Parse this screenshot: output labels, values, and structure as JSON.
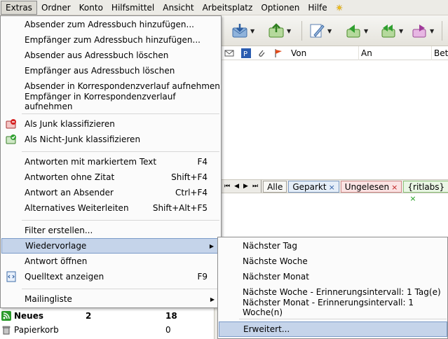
{
  "menubar": {
    "items": [
      "Extras",
      "Ordner",
      "Konto",
      "Hilfsmittel",
      "Ansicht",
      "Arbeitsplatz",
      "Optionen",
      "Hilfe"
    ],
    "extra_icon": "sun-icon"
  },
  "message_list": {
    "columns": {
      "from": "Von",
      "to": "An",
      "subject": "Betr"
    }
  },
  "tabs": {
    "all": "Alle",
    "parked": "Geparkt",
    "unread": "Ungelesen",
    "ritlabs": "{ritlabs}",
    "close": "×"
  },
  "extras_menu": {
    "group1": [
      "Absender zum Adressbuch hinzufügen...",
      "Empfänger zum Adressbuch hinzufügen...",
      "Absender aus Adressbuch löschen",
      "Empfänger aus Adressbuch löschen",
      "Absender in Korrespondenzverlauf aufnehmen",
      "Empfänger in Korrespondenzverlauf aufnehmen"
    ],
    "junk": "Als Junk klassifizieren",
    "not_junk": "Als Nicht-Junk klassifizieren",
    "reply_marked": {
      "label": "Antworten mit markiertem Text",
      "shortcut": "F4"
    },
    "reply_no_quote": {
      "label": "Antworten ohne Zitat",
      "shortcut": "Shift+F4"
    },
    "reply_sender": {
      "label": "Antwort an Absender",
      "shortcut": "Ctrl+F4"
    },
    "alt_forward": {
      "label": "Alternatives Weiterleiten",
      "shortcut": "Shift+Alt+F5"
    },
    "create_filter": "Filter erstellen...",
    "followup": "Wiedervorlage",
    "open_reply": "Antwort öffnen",
    "show_source": {
      "label": "Quelltext anzeigen",
      "shortcut": "F9"
    },
    "mailing_list": "Mailingliste"
  },
  "followup_submenu": {
    "items": [
      "Nächster Tag",
      "Nächste Woche",
      "Nächster Monat",
      "Nächste Woche - Erinnerungsintervall: 1 Tag(e)",
      "Nächster Monat - Erinnerungsintervall: 1 Woche(n)"
    ],
    "advanced": "Erweitert..."
  },
  "folders": [
    {
      "name": "Neues",
      "unread": "2",
      "total": "18",
      "icon": "rss-icon",
      "bold": true
    },
    {
      "name": "Papierkorb",
      "unread": "",
      "total": "0",
      "icon": "trash-icon",
      "bold": false
    }
  ]
}
